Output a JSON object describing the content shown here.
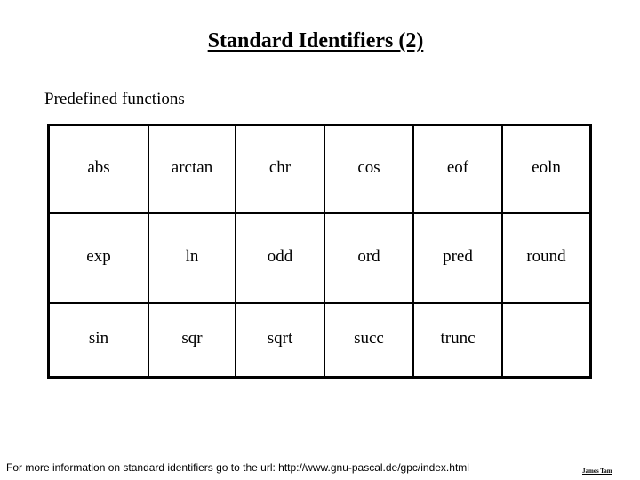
{
  "slide": {
    "title": "Standard Identifiers (2)",
    "subtitle": "Predefined functions",
    "table": {
      "rows": [
        [
          "abs",
          "arctan",
          "chr",
          "cos",
          "eof",
          "eoln"
        ],
        [
          "exp",
          "ln",
          "odd",
          "ord",
          "pred",
          "round"
        ],
        [
          "sin",
          "sqr",
          "sqrt",
          "succ",
          "trunc",
          ""
        ]
      ]
    },
    "footer": "For more information on standard identifiers go to the url: http://www.gnu-pascal.de/gpc/index.html",
    "author": "James Tam"
  }
}
